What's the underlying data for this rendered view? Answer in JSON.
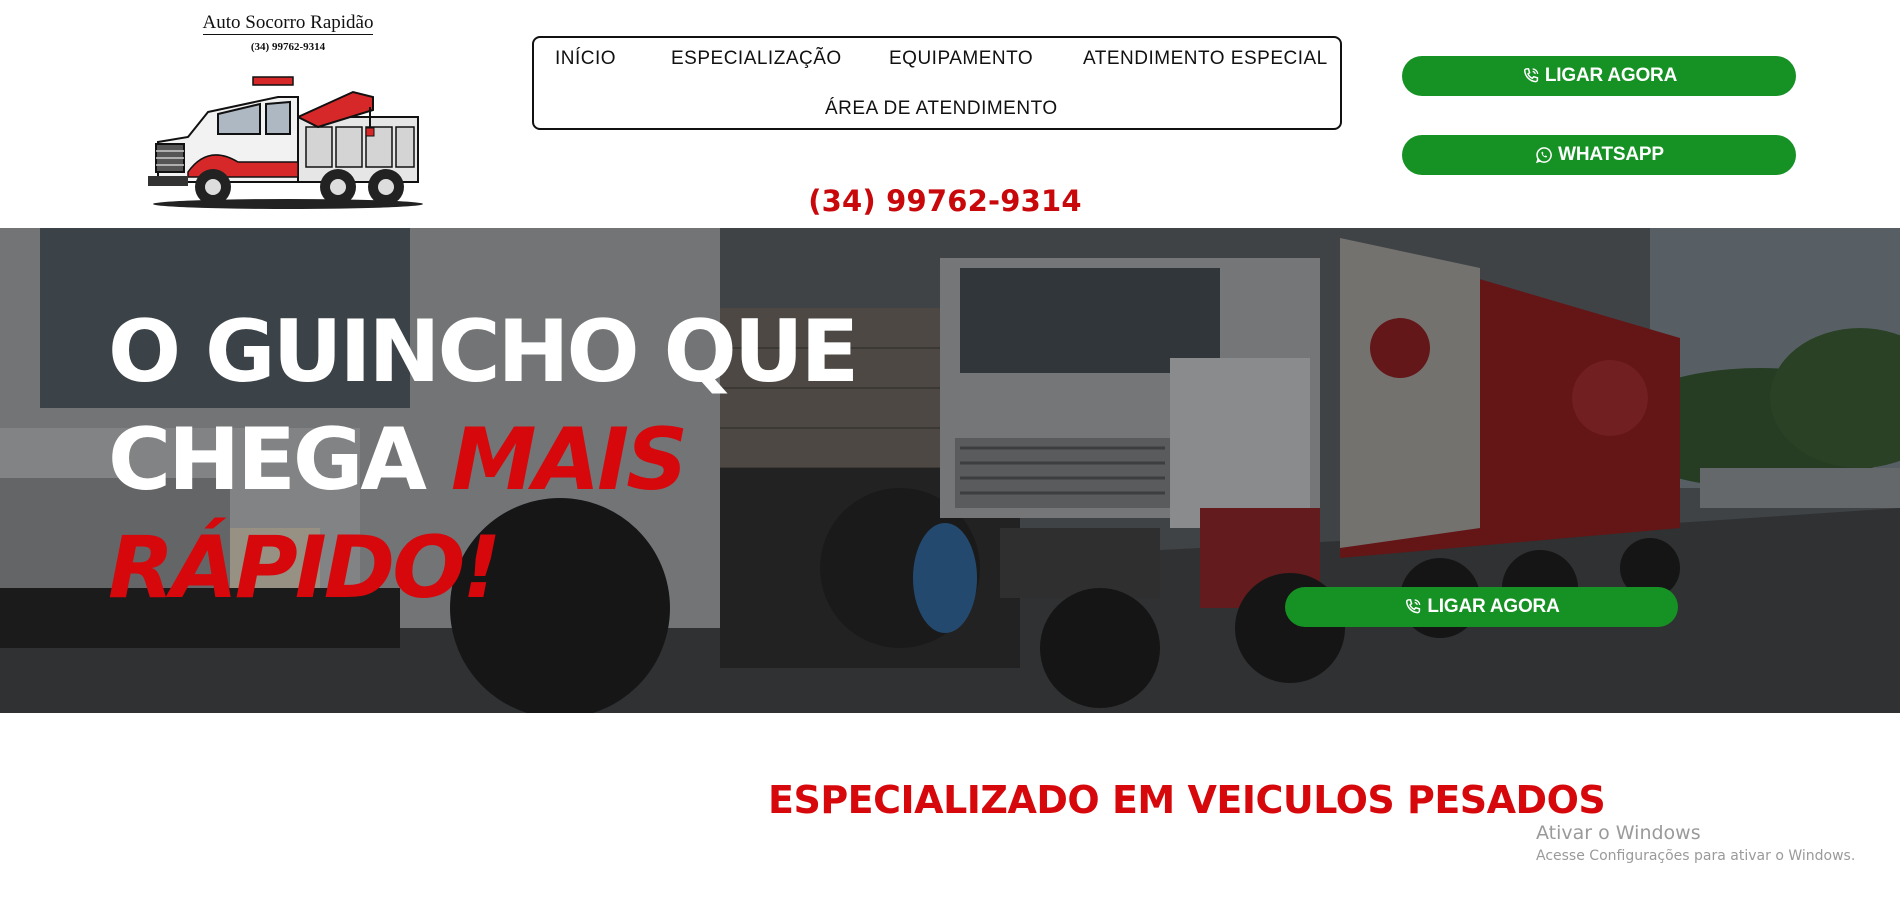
{
  "logo": {
    "brand_name": "Auto Socorro Rapidão",
    "phone": "(34) 99762-9314",
    "image_icon": "tow-truck-icon"
  },
  "nav": {
    "items": [
      {
        "label": "INÍCIO"
      },
      {
        "label": "ESPECIALIZAÇÃO"
      },
      {
        "label": "EQUIPAMENTO"
      },
      {
        "label": "ATENDIMENTO ESPECIAL"
      },
      {
        "label": "ÁREA DE ATENDIMENTO"
      }
    ]
  },
  "header": {
    "phone": "(34) 99762-9314",
    "call_button_label": "LIGAR AGORA",
    "call_button_icon": "phone-icon",
    "whatsapp_button_label": "WHATSAPP",
    "whatsapp_button_icon": "whatsapp-icon"
  },
  "hero": {
    "title_line1": "O GUINCHO QUE",
    "title_line2_white": "CHEGA ",
    "title_line2_red": "MAIS",
    "title_line3_red": "RÁPIDO!",
    "call_button_label": "LIGAR AGORA",
    "background": "trucks-photo"
  },
  "section": {
    "title": "ESPECIALIZADO EM VEICULOS PESADOS"
  },
  "windows_watermark": {
    "line1": "Ativar o Windows",
    "line2": "Acesse Configurações para ativar o Windows."
  },
  "colors": {
    "accent_red": "#d6080c",
    "button_green": "#169124",
    "text_dark": "#111111"
  }
}
